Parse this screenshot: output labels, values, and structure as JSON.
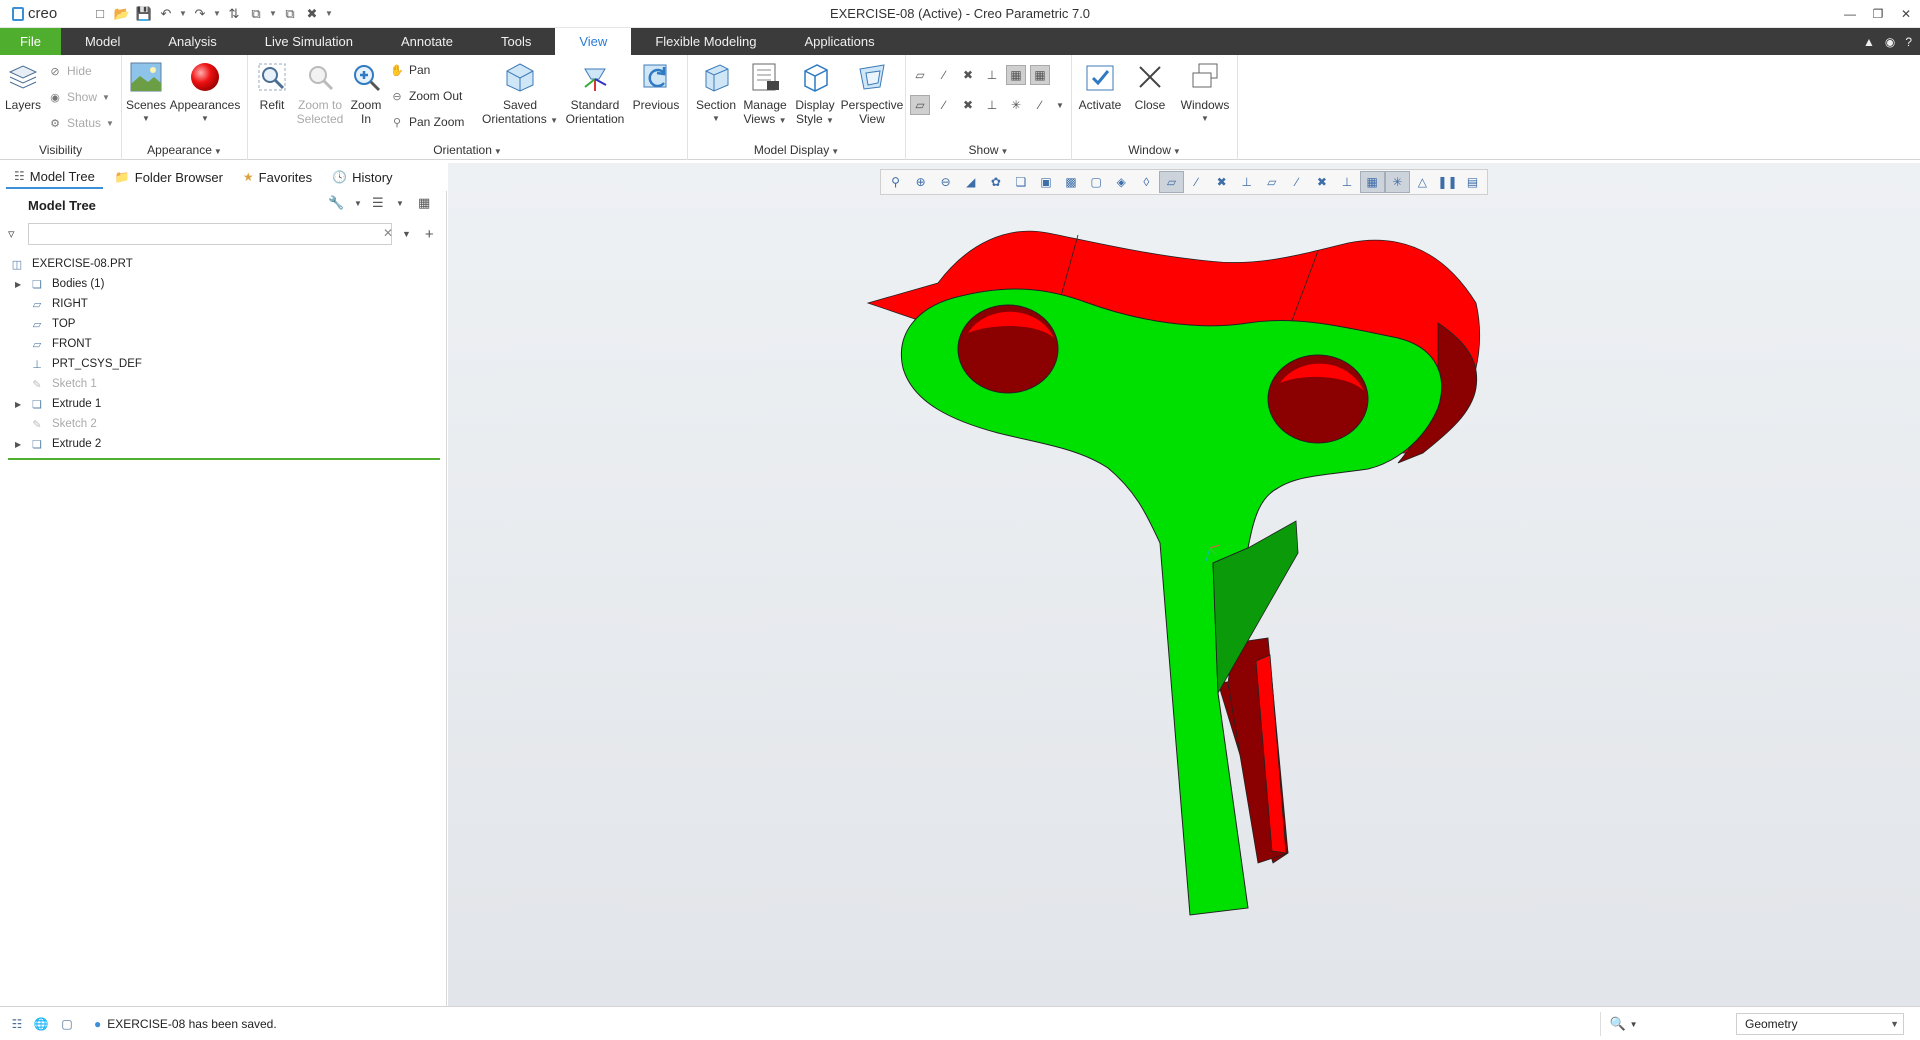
{
  "app": {
    "brand": "creo",
    "window_title": "EXERCISE-08 (Active) - Creo Parametric 7.0"
  },
  "tabs": [
    "File",
    "Model",
    "Analysis",
    "Live Simulation",
    "Annotate",
    "Tools",
    "View",
    "Flexible Modeling",
    "Applications"
  ],
  "active_tab": "View",
  "ribbon": {
    "visibility": {
      "label": "Visibility",
      "layers": "Layers",
      "hide": "Hide",
      "show": "Show",
      "status": "Status"
    },
    "appearance": {
      "label": "Appearance",
      "scenes": "Scenes",
      "appearances": "Appearances"
    },
    "orientation": {
      "label": "Orientation",
      "refit": "Refit",
      "zoom_to_selected_1": "Zoom to",
      "zoom_to_selected_2": "Selected",
      "zoom_in_1": "Zoom",
      "zoom_in_2": "In",
      "pan": "Pan",
      "zoom_out": "Zoom Out",
      "pan_zoom": "Pan Zoom",
      "saved_1": "Saved",
      "saved_2": "Orientations",
      "standard_1": "Standard",
      "standard_2": "Orientation",
      "previous": "Previous"
    },
    "model_display": {
      "label": "Model Display",
      "section": "Section",
      "manage_1": "Manage",
      "manage_2": "Views",
      "display_1": "Display",
      "display_2": "Style",
      "perspective_1": "Perspective",
      "perspective_2": "View"
    },
    "show": {
      "label": "Show"
    },
    "window": {
      "label": "Window",
      "activate": "Activate",
      "close": "Close",
      "windows": "Windows"
    }
  },
  "nav_tabs": [
    "Model Tree",
    "Folder Browser",
    "Favorites",
    "History"
  ],
  "model_tree": {
    "title": "Model Tree",
    "filter_placeholder": "",
    "items": [
      {
        "label": "EXERCISE-08.PRT",
        "icon": "part-icon",
        "level": 0,
        "expandable": false,
        "dim": false
      },
      {
        "label": "Bodies (1)",
        "icon": "bodies-icon",
        "level": 1,
        "expandable": true,
        "dim": false
      },
      {
        "label": "RIGHT",
        "icon": "datum-plane-icon",
        "level": 1,
        "expandable": false,
        "dim": false
      },
      {
        "label": "TOP",
        "icon": "datum-plane-icon",
        "level": 1,
        "expandable": false,
        "dim": false
      },
      {
        "label": "FRONT",
        "icon": "datum-plane-icon",
        "level": 1,
        "expandable": false,
        "dim": false
      },
      {
        "label": "PRT_CSYS_DEF",
        "icon": "csys-icon",
        "level": 1,
        "expandable": false,
        "dim": false
      },
      {
        "label": "Sketch 1",
        "icon": "sketch-icon",
        "level": 1,
        "expandable": false,
        "dim": true
      },
      {
        "label": "Extrude 1",
        "icon": "extrude-icon",
        "level": 1,
        "expandable": true,
        "dim": false
      },
      {
        "label": "Sketch 2",
        "icon": "sketch-icon",
        "level": 1,
        "expandable": false,
        "dim": true
      },
      {
        "label": "Extrude 2",
        "icon": "extrude-icon",
        "level": 1,
        "expandable": true,
        "dim": false
      }
    ]
  },
  "model_colors": {
    "front_face": "#00e000",
    "side_face": "#ff0000",
    "shadow_side": "#8b0000"
  },
  "status": {
    "message": "EXERCISE-08 has been saved.",
    "selection_filter": "Geometry"
  }
}
